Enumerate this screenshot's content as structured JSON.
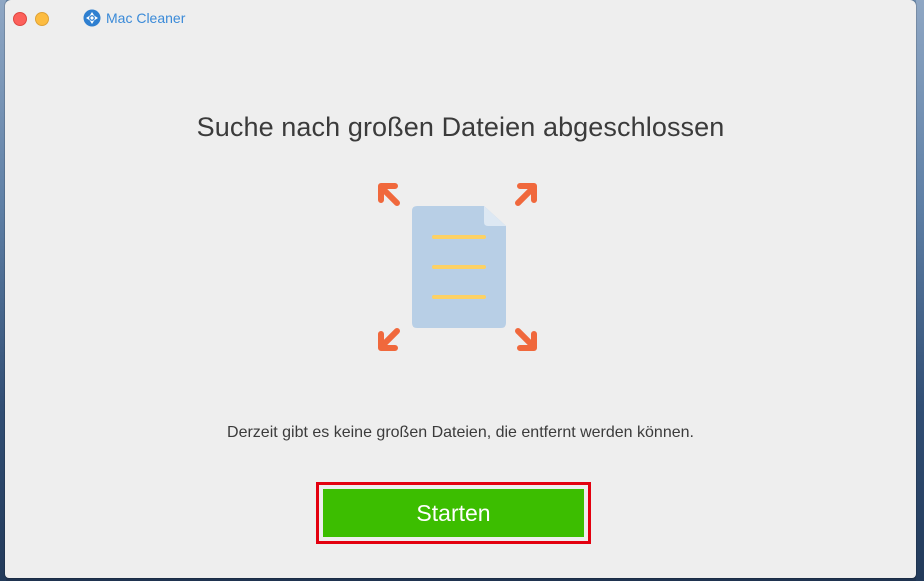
{
  "window": {
    "app_name": "Mac Cleaner",
    "controls": [
      "close",
      "minimize"
    ]
  },
  "main": {
    "heading": "Suche nach großen Dateien abgeschlossen",
    "illustration_icon": "expand-document-icon",
    "message": "Derzeit gibt es keine großen Dateien, die entfernt werden können.",
    "start_label": "Starten"
  },
  "colors": {
    "accent_green": "#3cbe00",
    "highlight_red": "#e3000f",
    "arrow_orange": "#f0683c",
    "document_blue": "#b8cfe6",
    "document_lines": "#fcd164",
    "app_name_blue": "#3a8ad8"
  }
}
